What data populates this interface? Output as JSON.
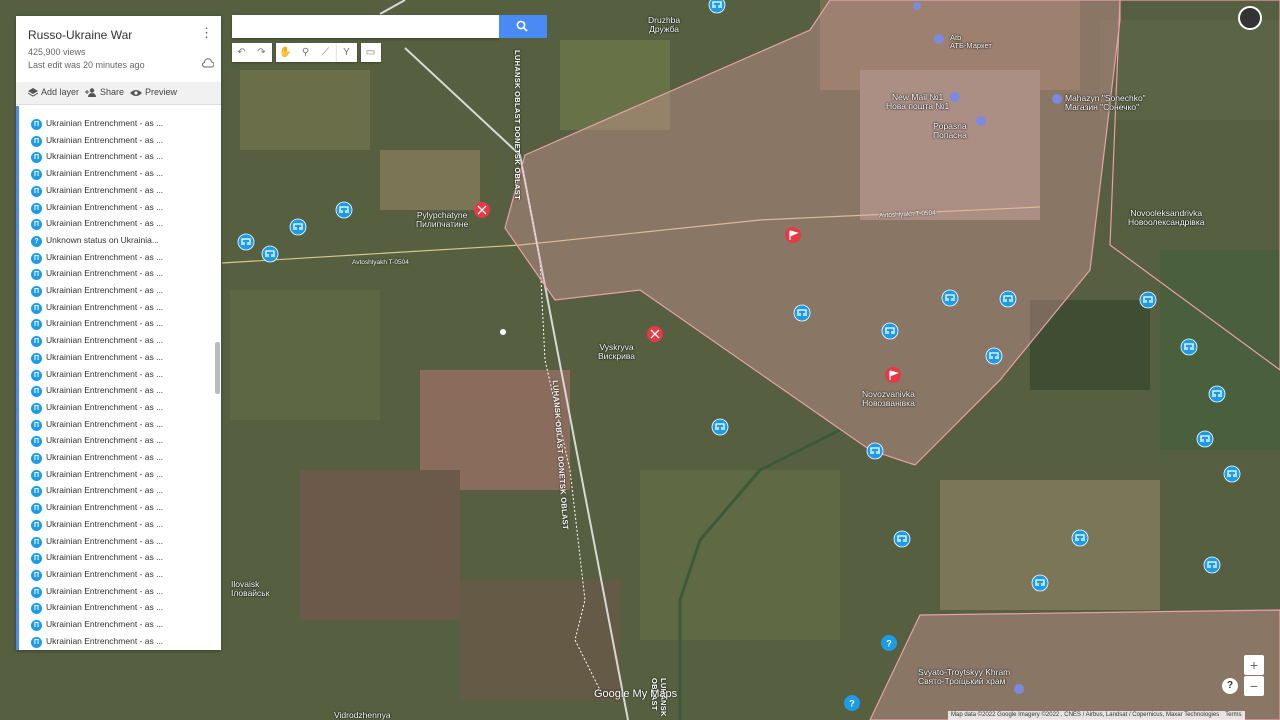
{
  "panel": {
    "title": "Russo-Ukraine War",
    "views": "425,900 views",
    "last_edit": "Last edit was 20 minutes ago",
    "actions": {
      "add_layer": "Add layer",
      "share": "Share",
      "preview": "Preview"
    },
    "items": [
      "Ukrainian Entrenchment - as ...",
      "Ukrainian Entrenchment - as ...",
      "Ukrainian Entrenchment - as ...",
      "Ukrainian Entrenchment - as ...",
      "Ukrainian Entrenchment - as ...",
      "Ukrainian Entrenchment - as ...",
      "Ukrainian Entrenchment - as ...",
      "Unknown status on Ukrainia...",
      "Ukrainian Entrenchment - as ...",
      "Ukrainian Entrenchment - as ...",
      "Ukrainian Entrenchment - as ...",
      "Ukrainian Entrenchment - as ...",
      "Ukrainian Entrenchment - as ...",
      "Ukrainian Entrenchment - as ...",
      "Ukrainian Entrenchment - as ...",
      "Ukrainian Entrenchment - as ...",
      "Ukrainian Entrenchment - as ...",
      "Ukrainian Entrenchment - as ...",
      "Ukrainian Entrenchment - as ...",
      "Ukrainian Entrenchment - as ...",
      "Ukrainian Entrenchment - as ...",
      "Ukrainian Entrenchment - as ...",
      "Ukrainian Entrenchment - as ...",
      "Ukrainian Entrenchment - as ...",
      "Ukrainian Entrenchment - as ...",
      "Ukrainian Entrenchment - as ...",
      "Ukrainian Entrenchment - as ...",
      "Ukrainian Entrenchment - as ...",
      "Ukrainian Entrenchment - as ...",
      "Ukrainian Entrenchment - as ...",
      "Ukrainian Entrenchment - as ...",
      "Ukrainian Entrenchment - as ...",
      "Ukrainian Entrenchment - as ..."
    ]
  },
  "map": {
    "places": {
      "druzhba": "Druzhba\nДружба",
      "atb": "Atb\nАТБ-Маркет",
      "new_mail": "New Mail №1\nНова пошта №1",
      "mahazyn": "Mahazyn \"Sonechko\"\nМагазин \"Сонечко\"",
      "popasna": "Popasna\nПопасна",
      "novooleksandrivka": "Novooleksandrivka\nНовоолександрівка",
      "pylypchatyne": "Pylypchatyne\nПилипчатине",
      "vyskryva": "Vyskryva\nВискрива",
      "novozvanivka": "Novozvanivka\nНовозванівка",
      "ilovaisk": "Ilovaisk\nІловайськ",
      "svyato": "Svyato-Troytskyy Khram\nСвято-Троїцький храм",
      "vidrodzhennya": "Vidrodzhennya"
    },
    "roads": {
      "road1": "Avtoshlyakh T-0504",
      "road2": "Avtoshlyakh T-0504"
    },
    "oblasts": {
      "top": "LUHANSK OBLAST   DONETSK OBLAST",
      "mid": "LUHANSK OBLAST   DONETSK OBLAST",
      "bottom": "LUHANSK OBLAST"
    },
    "colors": {
      "occupied": "#e8a0a8",
      "marker": "#1c9be6",
      "clash": "#e53945"
    }
  },
  "attribution": "Map data ©2022 Google Imagery ©2022 , CNES / Airbus, Landsat / Copernicus, Maxar Technologies",
  "terms": "Terms",
  "brand": "Google My Maps"
}
